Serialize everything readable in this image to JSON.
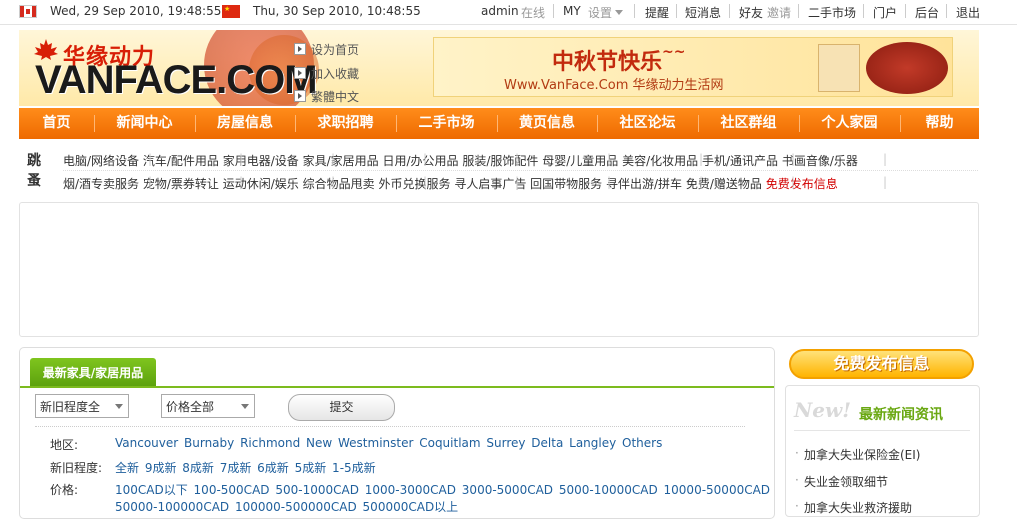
{
  "topbar": {
    "time_ca": "Wed, 29 Sep 2010, 19:48:55",
    "time_cn": "Thu, 30 Sep 2010, 10:48:55",
    "user": "admin",
    "online": "在线",
    "my": "MY",
    "settings": "设置",
    "links": [
      "提醒",
      "短消息",
      "好友",
      "邀请",
      "二手市场",
      "门户",
      "后台",
      "退出"
    ]
  },
  "header": {
    "logo_cn": "华缘动力",
    "logo_en": "VANFACE.COM",
    "quick_links": [
      "设为首页",
      "加入收藏",
      "繁體中文"
    ],
    "banner_title": "中秋节快乐",
    "banner_tilde": "~~",
    "banner_sub": "Www.VanFace.Com 华缘动力生活网"
  },
  "nav": [
    "首页",
    "新闻中心",
    "房屋信息",
    "求职招聘",
    "二手市场",
    "黄页信息",
    "社区论坛",
    "社区群组",
    "个人家园",
    "帮助"
  ],
  "categories": {
    "label": "跳蚤",
    "row1": [
      "电脑/网络设备",
      "汽车/配件用品",
      "家用电器/设备",
      "家具/家居用品",
      "日用/办公用品",
      "服装/服饰配件",
      "母婴/儿童用品",
      "美容/化妆用品",
      "手机/通讯产品",
      "书画音像/乐器"
    ],
    "row2": [
      "烟/酒专卖服务",
      "宠物/票券转让",
      "运动休闲/娱乐",
      "综合物品甩卖",
      "外币兑换服务",
      "寻人启事广告",
      "回国带物服务",
      "寻伴出游/拼车",
      "免费/赠送物品",
      "免费发布信息"
    ]
  },
  "listing": {
    "tab": "最新家具/家居用品",
    "select_condition": "新旧程度全",
    "select_price": "价格全部",
    "submit": "提交",
    "filters": [
      {
        "label": "地区:",
        "values": "Vancouver Burnaby Richmond New Westminster Coquitlam Surrey Delta Langley Others"
      },
      {
        "label": "新旧程度:",
        "values": "全新 9成新 8成新 7成新 6成新 5成新 1-5成新"
      },
      {
        "label": "价格:",
        "values": "100CAD以下 100-500CAD 500-1000CAD 1000-3000CAD 3000-5000CAD 5000-10000CAD 10000-50000CAD"
      },
      {
        "label": "",
        "values": "50000-100000CAD 100000-500000CAD 500000CAD以上"
      }
    ]
  },
  "sidebar": {
    "free_post": "免费发布信息",
    "new_badge": "New!",
    "news_title": "最新新闻资讯",
    "news": [
      "加拿大失业保险金(EI)",
      "失业金领取细节",
      "加拿大失业救济援助"
    ]
  },
  "colors": {
    "nav_orange": "#f07a0a",
    "tab_green": "#6cb215",
    "link_blue": "#1f5f9c"
  }
}
